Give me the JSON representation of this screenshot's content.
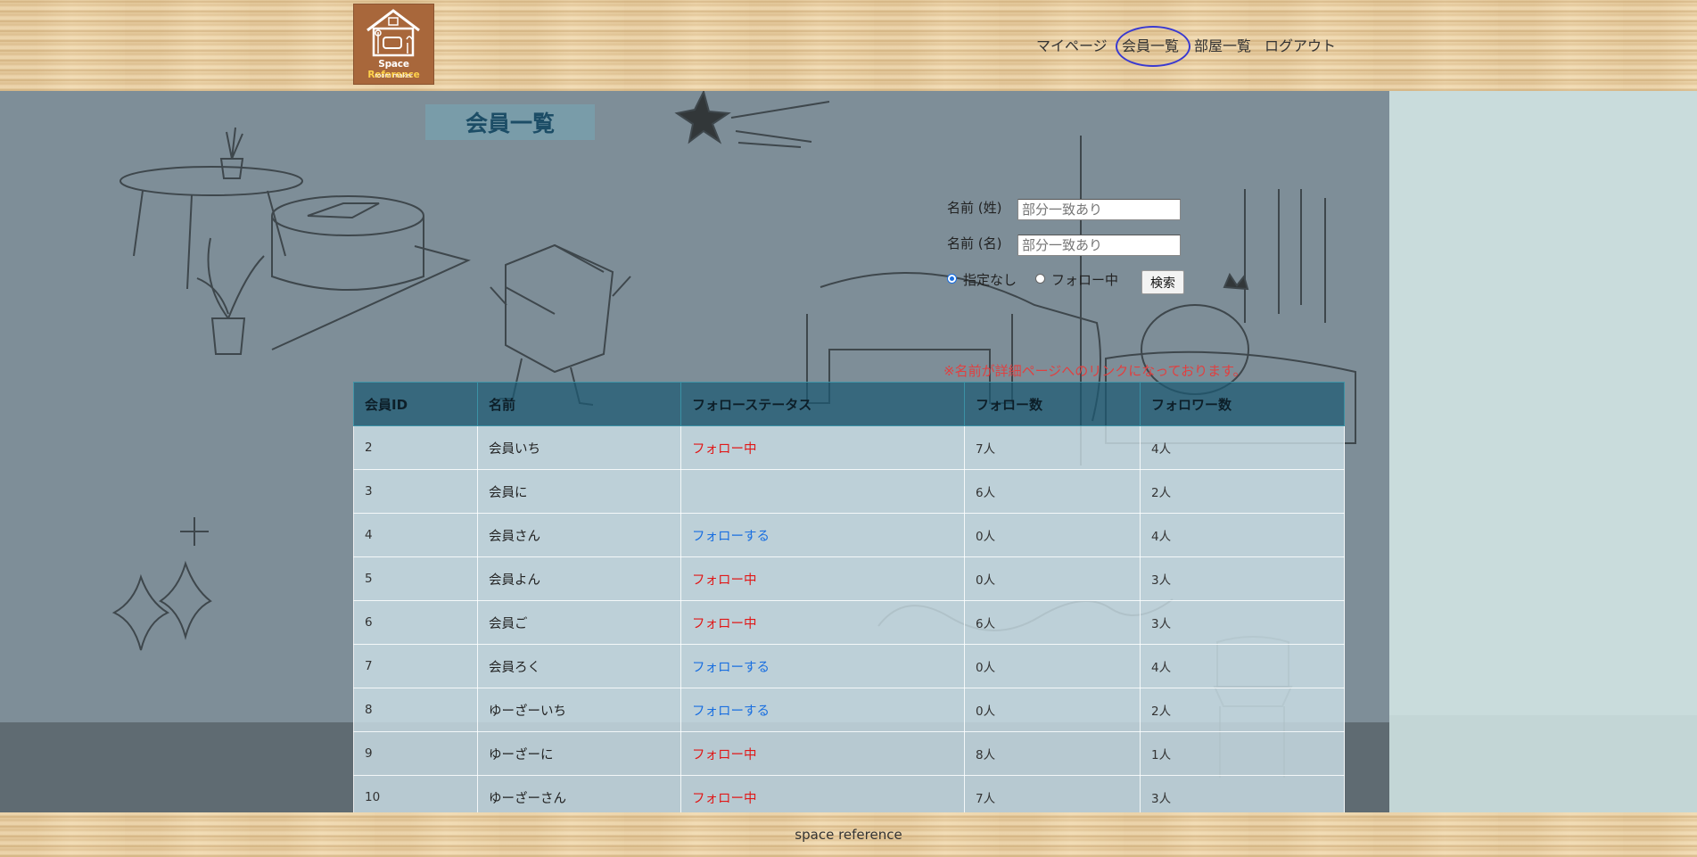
{
  "header": {
    "logo": {
      "brand_white": "Space ",
      "brand_yellow": "Reference",
      "tagline": "room maker"
    },
    "nav": [
      "マイページ",
      "会員一覧",
      "部屋一覧",
      "ログアウト"
    ]
  },
  "page": {
    "title": "会員一覧"
  },
  "search": {
    "last_name_label": "名前 (姓)",
    "last_name_placeholder": "部分一致あり",
    "first_name_label": "名前 (名)",
    "first_name_placeholder": "部分一致あり",
    "radio_none": "指定なし",
    "radio_following": "フォロー中",
    "button": "検索"
  },
  "note": "※名前が詳細ページへのリンクになっております。",
  "table": {
    "headers": [
      "会員ID",
      "名前",
      "フォローステータス",
      "フォロー数",
      "フォロワー数"
    ],
    "rows": [
      {
        "id": "2",
        "name": "会員いち",
        "status": "フォロー中",
        "following": "7人",
        "followers": "4人"
      },
      {
        "id": "3",
        "name": "会員に",
        "status": "",
        "following": "6人",
        "followers": "2人"
      },
      {
        "id": "4",
        "name": "会員さん",
        "status": "フォローする",
        "following": "0人",
        "followers": "4人"
      },
      {
        "id": "5",
        "name": "会員よん",
        "status": "フォロー中",
        "following": "0人",
        "followers": "3人"
      },
      {
        "id": "6",
        "name": "会員ご",
        "status": "フォロー中",
        "following": "6人",
        "followers": "3人"
      },
      {
        "id": "7",
        "name": "会員ろく",
        "status": "フォローする",
        "following": "0人",
        "followers": "4人"
      },
      {
        "id": "8",
        "name": "ゆーざーいち",
        "status": "フォローする",
        "following": "0人",
        "followers": "2人"
      },
      {
        "id": "9",
        "name": "ゆーざーに",
        "status": "フォロー中",
        "following": "8人",
        "followers": "1人"
      },
      {
        "id": "10",
        "name": "ゆーざーさん",
        "status": "フォロー中",
        "following": "7人",
        "followers": "3人"
      }
    ]
  },
  "footer": {
    "text": "space reference"
  },
  "colors": {
    "follow_active": "#e01818",
    "follow_link": "#1a6fe0",
    "nav_ring": "#3a3ad0",
    "logo_bg": "#a8673b"
  }
}
